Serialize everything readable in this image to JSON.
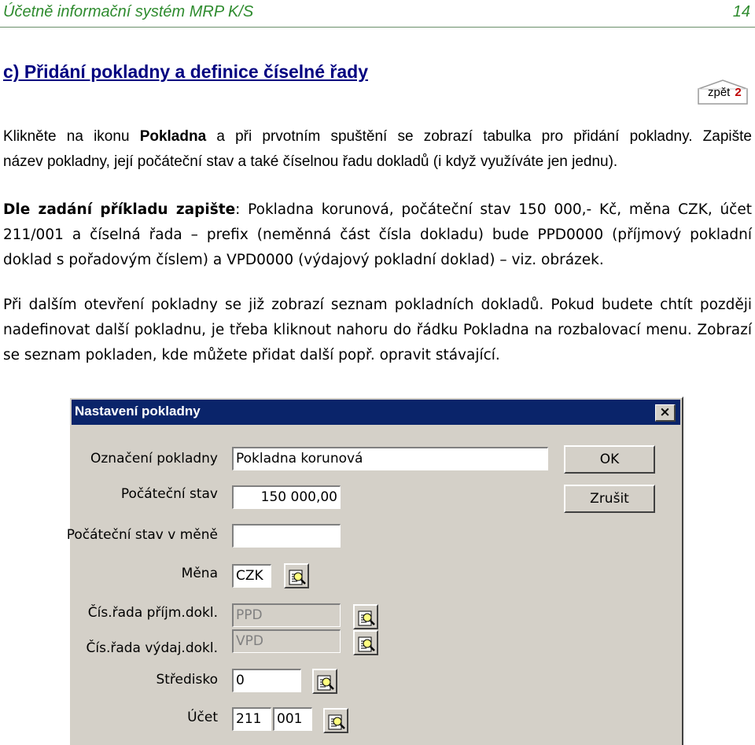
{
  "header": {
    "title": "Účetně informační systém MRP K/S",
    "page_number": "14"
  },
  "section_title": "c) Přidání pokladny a definice číselné řady",
  "back_link": {
    "label": "zpět",
    "number": "2"
  },
  "paragraphs": {
    "p1": {
      "lines": [
        [
          "Klikněte na ikonu ",
          "Pokladna",
          " a při prvotním spuštění se zobrazí tabulka pro přidání pokladny. Zapište"
        ],
        [
          "název pokladny, její počáteční stav a také číselnou řadu dokladů (i když využíváte jen jednu)."
        ]
      ]
    },
    "p2": {
      "bold_lead": "Dle zadání příkladu zapište",
      "line1_rest": ": Pokladna korunová, počáteční stav 150 000,- Kč, měna CZK, účet",
      "line2": "211/001 a číselná řada – prefix (neměnná část čísla dokladu) bude PPD0000 (příjmový pokladní",
      "line3": "doklad s pořadovým  číslem) a VPD0000 (výdajový pokladní doklad) – viz. obrázek."
    },
    "p3": {
      "line1": "Při dalším otevření pokladny se již zobrazí seznam pokladních dokladů. Pokud budete chtít později",
      "line2": "nadefinovat další pokladnu, je třeba kliknout nahoru do řádku Pokladna na rozbalovací menu. Zobrazí",
      "line3": "se seznam pokladen, kde můžete přidat další popř. opravit stávající."
    }
  },
  "dialog": {
    "title": "Nastavení pokladny",
    "close_glyph": "×",
    "ok_label": "OK",
    "cancel_label": "Zrušit",
    "fields": {
      "oznaceni": {
        "label": "Označení pokladny",
        "value": "Pokladna korunová"
      },
      "pocatecni": {
        "label": "Počáteční stav",
        "value": "150 000,00"
      },
      "pocatecni_mena": {
        "label": "Počáteční stav v měně",
        "value": ""
      },
      "mena": {
        "label": "Měna",
        "value": "CZK"
      },
      "rada_prijem": {
        "label": "Čís.řada příjm.dokl.",
        "value": "PPD"
      },
      "rada_vydaj": {
        "label": "Čís.řada výdaj.dokl.",
        "value": "VPD"
      },
      "stredisko": {
        "label": "Středisko",
        "value": "0"
      },
      "ucet": {
        "label": "Účet",
        "value1": "211",
        "value2": "001"
      }
    },
    "icons": {
      "lookup": "lookup-icon",
      "close": "close-icon"
    }
  },
  "colors": {
    "header_green": "#2e8b2e",
    "section_navy": "#000080",
    "titlebar": "#0a246a",
    "dialog_face": "#d4d0c8",
    "back_number_red": "#c00000"
  }
}
